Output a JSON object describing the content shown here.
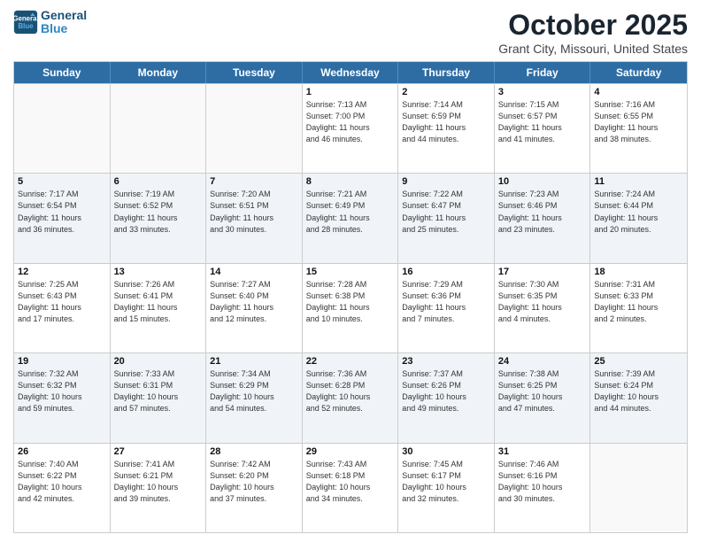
{
  "logo": {
    "line1": "General",
    "line2": "Blue"
  },
  "title": "October 2025",
  "location": "Grant City, Missouri, United States",
  "days_of_week": [
    "Sunday",
    "Monday",
    "Tuesday",
    "Wednesday",
    "Thursday",
    "Friday",
    "Saturday"
  ],
  "weeks": [
    [
      {
        "day": "",
        "info": ""
      },
      {
        "day": "",
        "info": ""
      },
      {
        "day": "",
        "info": ""
      },
      {
        "day": "1",
        "info": "Sunrise: 7:13 AM\nSunset: 7:00 PM\nDaylight: 11 hours\nand 46 minutes."
      },
      {
        "day": "2",
        "info": "Sunrise: 7:14 AM\nSunset: 6:59 PM\nDaylight: 11 hours\nand 44 minutes."
      },
      {
        "day": "3",
        "info": "Sunrise: 7:15 AM\nSunset: 6:57 PM\nDaylight: 11 hours\nand 41 minutes."
      },
      {
        "day": "4",
        "info": "Sunrise: 7:16 AM\nSunset: 6:55 PM\nDaylight: 11 hours\nand 38 minutes."
      }
    ],
    [
      {
        "day": "5",
        "info": "Sunrise: 7:17 AM\nSunset: 6:54 PM\nDaylight: 11 hours\nand 36 minutes."
      },
      {
        "day": "6",
        "info": "Sunrise: 7:19 AM\nSunset: 6:52 PM\nDaylight: 11 hours\nand 33 minutes."
      },
      {
        "day": "7",
        "info": "Sunrise: 7:20 AM\nSunset: 6:51 PM\nDaylight: 11 hours\nand 30 minutes."
      },
      {
        "day": "8",
        "info": "Sunrise: 7:21 AM\nSunset: 6:49 PM\nDaylight: 11 hours\nand 28 minutes."
      },
      {
        "day": "9",
        "info": "Sunrise: 7:22 AM\nSunset: 6:47 PM\nDaylight: 11 hours\nand 25 minutes."
      },
      {
        "day": "10",
        "info": "Sunrise: 7:23 AM\nSunset: 6:46 PM\nDaylight: 11 hours\nand 23 minutes."
      },
      {
        "day": "11",
        "info": "Sunrise: 7:24 AM\nSunset: 6:44 PM\nDaylight: 11 hours\nand 20 minutes."
      }
    ],
    [
      {
        "day": "12",
        "info": "Sunrise: 7:25 AM\nSunset: 6:43 PM\nDaylight: 11 hours\nand 17 minutes."
      },
      {
        "day": "13",
        "info": "Sunrise: 7:26 AM\nSunset: 6:41 PM\nDaylight: 11 hours\nand 15 minutes."
      },
      {
        "day": "14",
        "info": "Sunrise: 7:27 AM\nSunset: 6:40 PM\nDaylight: 11 hours\nand 12 minutes."
      },
      {
        "day": "15",
        "info": "Sunrise: 7:28 AM\nSunset: 6:38 PM\nDaylight: 11 hours\nand 10 minutes."
      },
      {
        "day": "16",
        "info": "Sunrise: 7:29 AM\nSunset: 6:36 PM\nDaylight: 11 hours\nand 7 minutes."
      },
      {
        "day": "17",
        "info": "Sunrise: 7:30 AM\nSunset: 6:35 PM\nDaylight: 11 hours\nand 4 minutes."
      },
      {
        "day": "18",
        "info": "Sunrise: 7:31 AM\nSunset: 6:33 PM\nDaylight: 11 hours\nand 2 minutes."
      }
    ],
    [
      {
        "day": "19",
        "info": "Sunrise: 7:32 AM\nSunset: 6:32 PM\nDaylight: 10 hours\nand 59 minutes."
      },
      {
        "day": "20",
        "info": "Sunrise: 7:33 AM\nSunset: 6:31 PM\nDaylight: 10 hours\nand 57 minutes."
      },
      {
        "day": "21",
        "info": "Sunrise: 7:34 AM\nSunset: 6:29 PM\nDaylight: 10 hours\nand 54 minutes."
      },
      {
        "day": "22",
        "info": "Sunrise: 7:36 AM\nSunset: 6:28 PM\nDaylight: 10 hours\nand 52 minutes."
      },
      {
        "day": "23",
        "info": "Sunrise: 7:37 AM\nSunset: 6:26 PM\nDaylight: 10 hours\nand 49 minutes."
      },
      {
        "day": "24",
        "info": "Sunrise: 7:38 AM\nSunset: 6:25 PM\nDaylight: 10 hours\nand 47 minutes."
      },
      {
        "day": "25",
        "info": "Sunrise: 7:39 AM\nSunset: 6:24 PM\nDaylight: 10 hours\nand 44 minutes."
      }
    ],
    [
      {
        "day": "26",
        "info": "Sunrise: 7:40 AM\nSunset: 6:22 PM\nDaylight: 10 hours\nand 42 minutes."
      },
      {
        "day": "27",
        "info": "Sunrise: 7:41 AM\nSunset: 6:21 PM\nDaylight: 10 hours\nand 39 minutes."
      },
      {
        "day": "28",
        "info": "Sunrise: 7:42 AM\nSunset: 6:20 PM\nDaylight: 10 hours\nand 37 minutes."
      },
      {
        "day": "29",
        "info": "Sunrise: 7:43 AM\nSunset: 6:18 PM\nDaylight: 10 hours\nand 34 minutes."
      },
      {
        "day": "30",
        "info": "Sunrise: 7:45 AM\nSunset: 6:17 PM\nDaylight: 10 hours\nand 32 minutes."
      },
      {
        "day": "31",
        "info": "Sunrise: 7:46 AM\nSunset: 6:16 PM\nDaylight: 10 hours\nand 30 minutes."
      },
      {
        "day": "",
        "info": ""
      }
    ]
  ]
}
